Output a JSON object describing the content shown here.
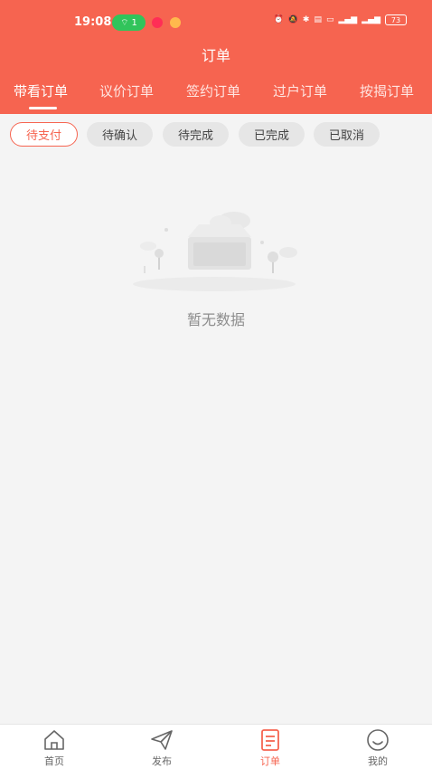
{
  "status_bar": {
    "time": "19:08",
    "hotspot_count": "1",
    "battery": "73"
  },
  "header": {
    "title": "订单"
  },
  "tabs": [
    {
      "label": "带看订单",
      "active": true
    },
    {
      "label": "议价订单",
      "active": false
    },
    {
      "label": "签约订单",
      "active": false
    },
    {
      "label": "过户订单",
      "active": false
    },
    {
      "label": "按揭订单",
      "active": false
    }
  ],
  "filters": [
    {
      "label": "待支付",
      "active": true
    },
    {
      "label": "待确认",
      "active": false
    },
    {
      "label": "待完成",
      "active": false
    },
    {
      "label": "已完成",
      "active": false
    },
    {
      "label": "已取消",
      "active": false
    }
  ],
  "empty_state": {
    "message": "暂无数据"
  },
  "bottom_nav": [
    {
      "label": "首页",
      "icon": "home-icon",
      "active": false
    },
    {
      "label": "发布",
      "icon": "send-icon",
      "active": false
    },
    {
      "label": "订单",
      "icon": "order-icon",
      "active": true
    },
    {
      "label": "我的",
      "icon": "profile-icon",
      "active": false
    }
  ],
  "colors": {
    "accent": "#f66450",
    "background": "#f4f4f4",
    "hotspot": "#31c45b"
  }
}
